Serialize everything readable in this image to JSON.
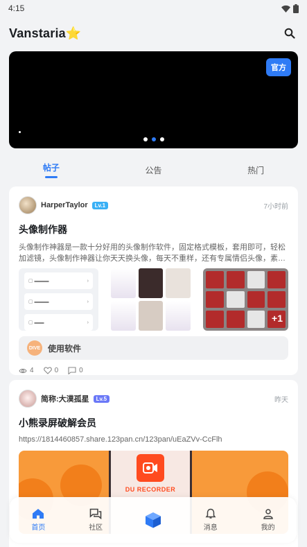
{
  "status": {
    "time": "4:15"
  },
  "header": {
    "title": "Vanstaria⭐",
    "search_icon": "search-icon"
  },
  "banner": {
    "badge": "官方"
  },
  "tabs": [
    {
      "label": "帖子",
      "active": true
    },
    {
      "label": "公告",
      "active": false
    },
    {
      "label": "热门",
      "active": false
    }
  ],
  "posts": [
    {
      "author": "HarperTaylor",
      "level": "Lv.1",
      "time": "7小时前",
      "title": "头像制作器",
      "body": "头像制作神器是一款十分好用的头像制作软件，固定格式模板，套用即可，轻松加滤镜，头像制作神器让你天天换头像，每天不重样，还有专属情侣头像，素…",
      "images_more": "+1",
      "app_chip": {
        "label": "使用软件",
        "logo_text": "DIVE"
      },
      "stats": {
        "views": "4",
        "likes": "0",
        "comments": "0"
      }
    },
    {
      "author": "简称:大漠孤星",
      "level": "Lv.5",
      "time": "昨天",
      "title": "小熊录屏破解会员",
      "link": "https://1814460857.share.123pan.cn/123pan/uEaZVv-CcFlh",
      "poster_text": "DU RECORDER"
    }
  ],
  "bottom_nav": [
    {
      "label": "首页",
      "icon": "home-icon",
      "active": true
    },
    {
      "label": "社区",
      "icon": "community-icon",
      "active": false
    },
    {
      "label": "",
      "icon": "cube-icon",
      "active": false
    },
    {
      "label": "消息",
      "icon": "bell-icon",
      "active": false
    },
    {
      "label": "我的",
      "icon": "profile-icon",
      "active": false
    }
  ],
  "colors": {
    "accent": "#2f7bf5",
    "background": "#f2f3f5"
  }
}
